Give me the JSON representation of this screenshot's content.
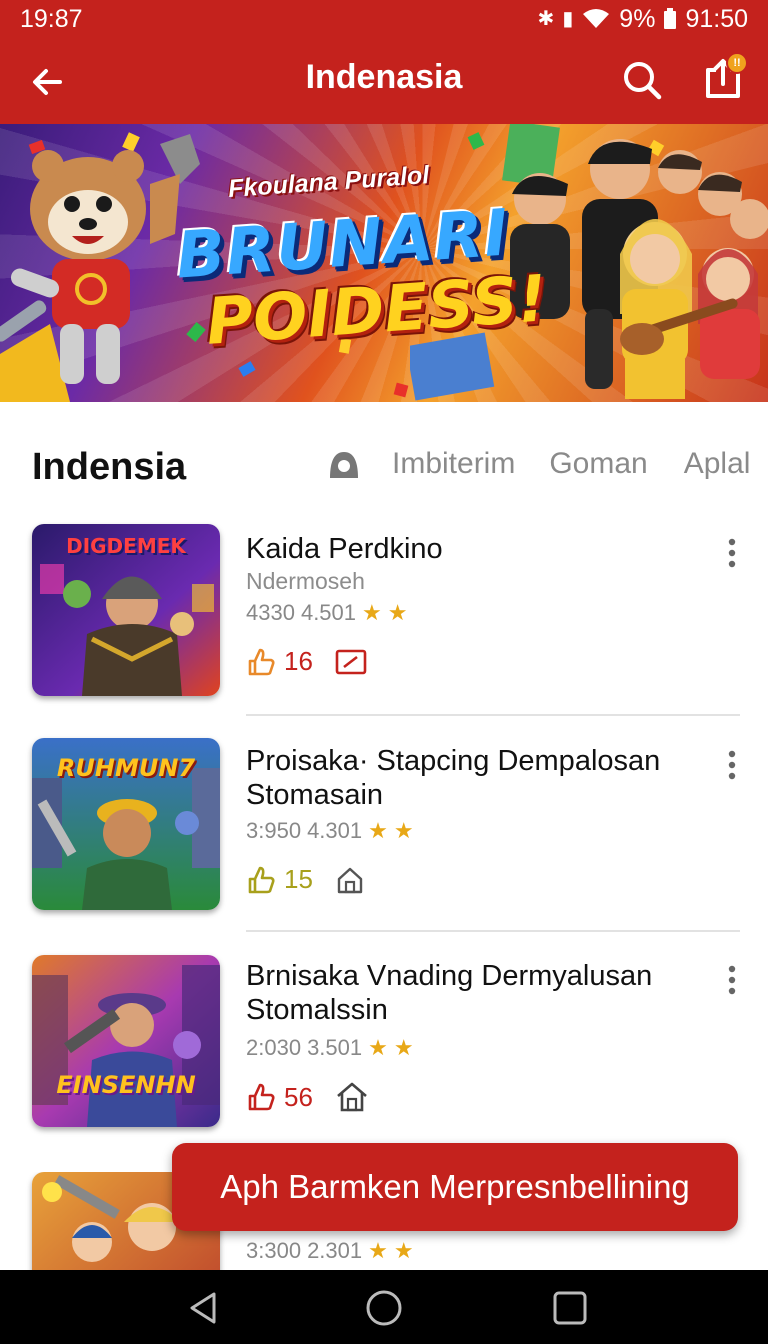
{
  "status": {
    "time": "19:87",
    "battery": "9%",
    "clock": "91:50"
  },
  "appbar": {
    "title": "Indenasia",
    "share_badge": "!!"
  },
  "banner": {
    "subtitle": "Fkoulana Puralol",
    "title_line1": "BRUNARI",
    "title_line2": "POIDESS!"
  },
  "section": {
    "title": "Indensia",
    "tabs": [
      "Imbiterim",
      "Goman",
      "Aplal"
    ]
  },
  "items": [
    {
      "title": "Kaida Perdkino",
      "subtitle": "Ndermoseh",
      "stat1": "4330",
      "stat2": "4.501",
      "count": "16",
      "thumb_text": "DIGDEMEK"
    },
    {
      "title": "Proisaka· Stapcing Dempalosan Stomasain",
      "stat1": "3:950",
      "stat2": "4.301",
      "count": "15",
      "thumb_text": "RUHMUN7"
    },
    {
      "title": "Brnisaka Vnading Dermyalusan Stomalssin",
      "stat1": "2:030",
      "stat2": "3.501",
      "count": "56",
      "thumb_text": "EINSENHN"
    },
    {
      "stat1": "3:300",
      "stat2": "2.301"
    }
  ],
  "fab": {
    "label": "Aph Barmken Merpresnbellining"
  },
  "colors": {
    "brand": "#c4221d",
    "star": "#e8a817"
  }
}
